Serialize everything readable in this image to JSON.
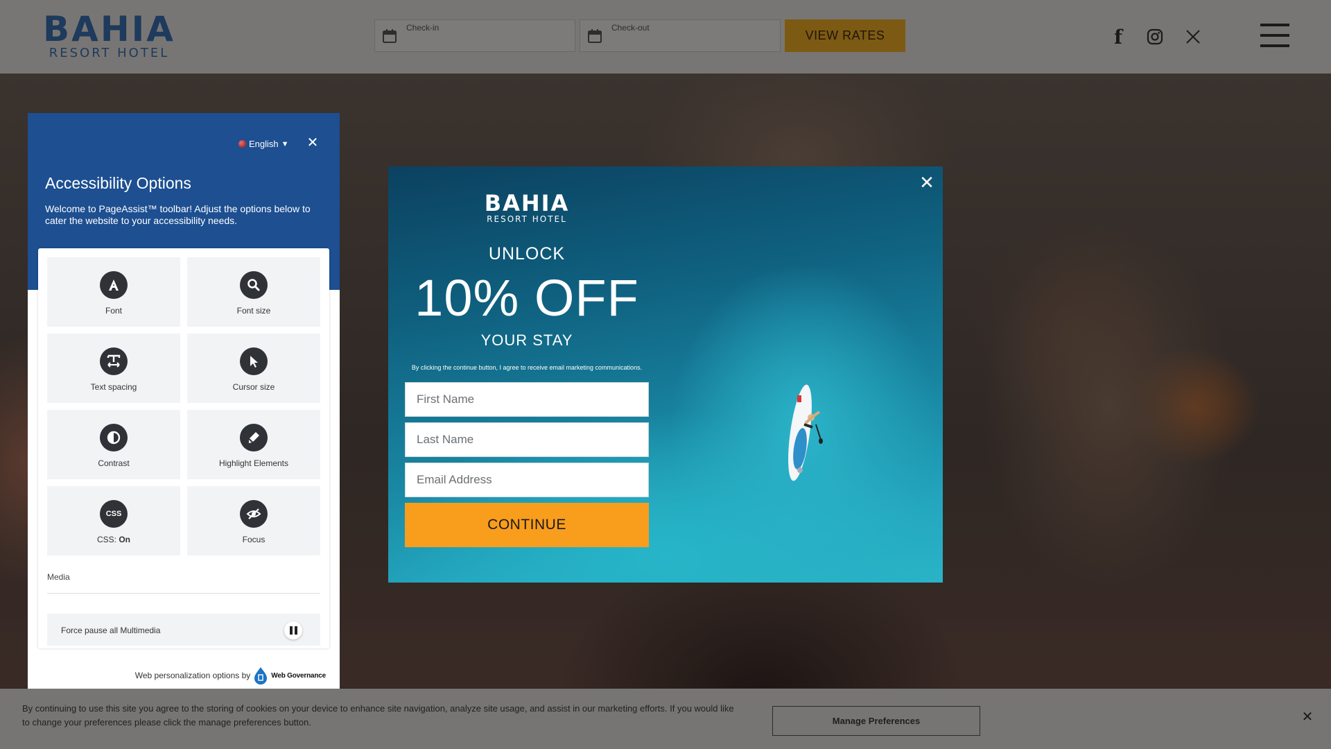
{
  "header": {
    "logo_brand": "BAHIA",
    "logo_sub": "RESORT HOTEL",
    "checkin_label": "Check-in",
    "checkout_label": "Check-out",
    "view_rates_label": "VIEW RATES",
    "social_icons": [
      "facebook-icon",
      "instagram-icon",
      "x-icon"
    ],
    "facebook_glyph": "f",
    "x_glyph": "𝕏"
  },
  "a11y": {
    "language": "English",
    "title": "Accessibility Options",
    "description": "Welcome to PageAssist™ toolbar! Adjust the options below to cater the website to your accessibility needs.",
    "tiles": [
      {
        "label": "Font",
        "icon": "font-icon"
      },
      {
        "label": "Font size",
        "icon": "search-icon"
      },
      {
        "label": "Text spacing",
        "icon": "text-spacing-icon"
      },
      {
        "label": "Cursor size",
        "icon": "cursor-icon"
      },
      {
        "label": "Contrast",
        "icon": "contrast-icon"
      },
      {
        "label": "Highlight Elements",
        "icon": "highlighter-icon"
      },
      {
        "label": "CSS: ",
        "value": "On",
        "icon": "css-icon"
      },
      {
        "label": "Focus",
        "icon": "focus-icon"
      }
    ],
    "media_heading": "Media",
    "pause_label": "Force pause all Multimedia",
    "powered_by": "Web personalization options by",
    "powered_brand": "Web Governance"
  },
  "promo": {
    "logo_brand": "BAHIA",
    "logo_sub": "RESORT HOTEL",
    "unlock": "UNLOCK",
    "discount": "10% OFF",
    "your_stay": "YOUR STAY",
    "consent": "By clicking the continue button, I agree to receive email marketing communications.",
    "first_name_placeholder": "First Name",
    "last_name_placeholder": "Last Name",
    "email_placeholder": "Email Address",
    "continue_label": "CONTINUE"
  },
  "cookie": {
    "text": "By continuing to use this site you agree to the storing of cookies on your device to enhance site navigation, analyze site usage, and assist in our marketing efforts. If you would like to change your preferences please click the manage preferences button.",
    "manage_label": "Manage Preferences"
  },
  "colors": {
    "a11y_blue": "#1d4f91",
    "cta_orange": "#f99d1c",
    "brand_navy": "#1e3a5c"
  }
}
